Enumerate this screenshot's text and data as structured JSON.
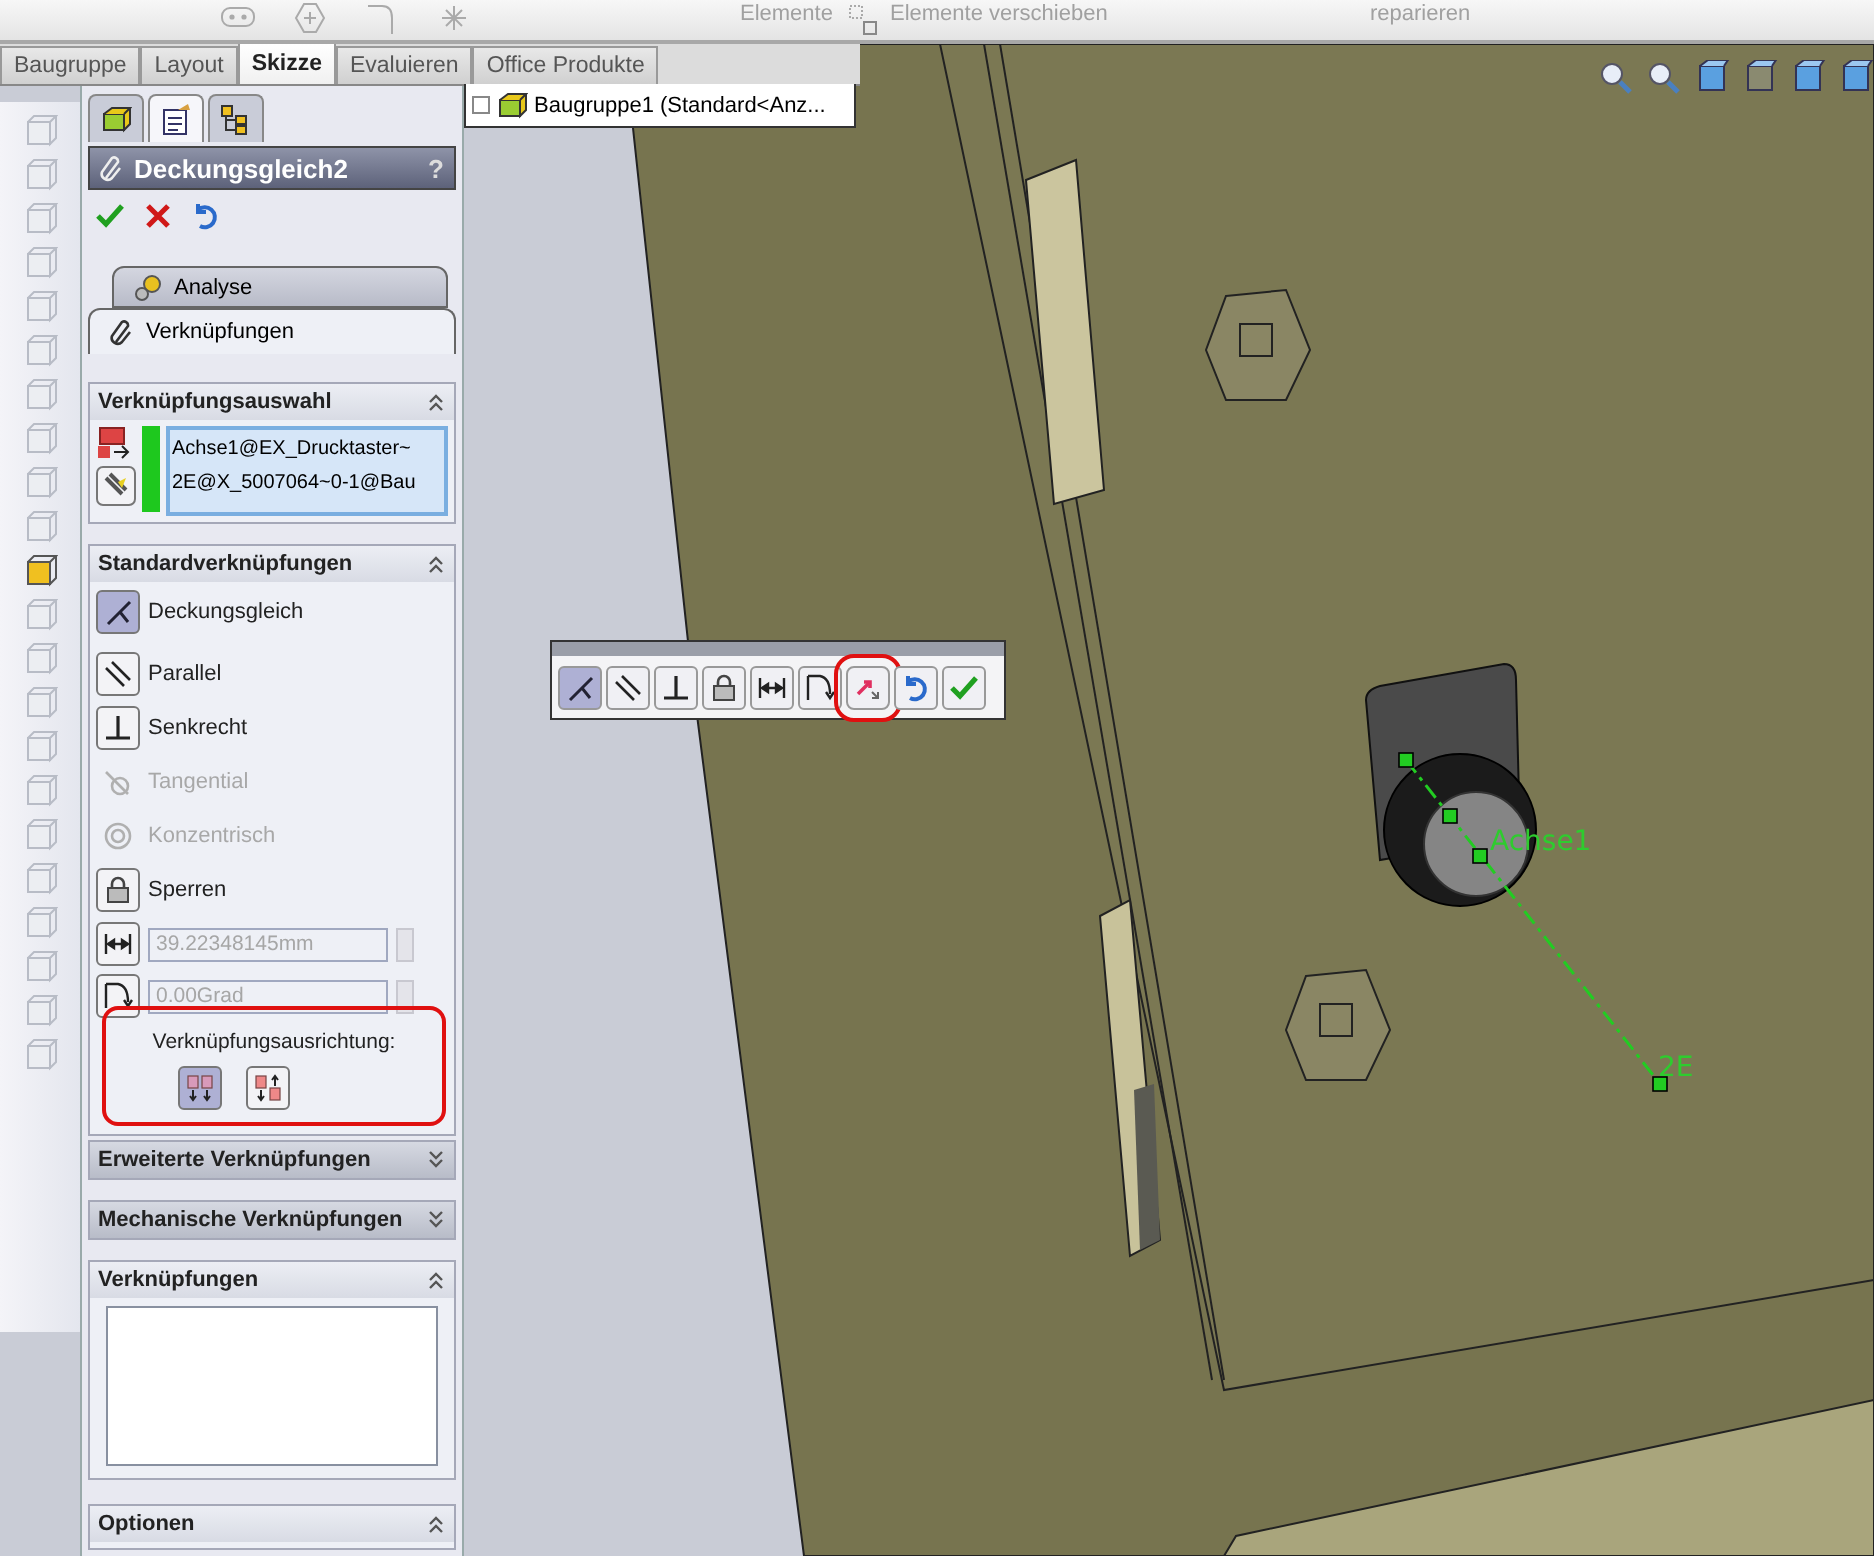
{
  "ribbon": {
    "labels": [
      "Elemente",
      "Elemente verschieben",
      "reparieren"
    ]
  },
  "tabs": [
    {
      "label": "Baugruppe",
      "selected": false
    },
    {
      "label": "Layout",
      "selected": false
    },
    {
      "label": "Skizze",
      "selected": true
    },
    {
      "label": "Evaluieren",
      "selected": false
    },
    {
      "label": "Office Produkte",
      "selected": false
    }
  ],
  "feature_tree": {
    "root": "Baugruppe1  (Standard<Anz..."
  },
  "property_manager": {
    "tabs": [
      {
        "kind": "tree",
        "selected": false
      },
      {
        "kind": "properties",
        "selected": true
      },
      {
        "kind": "config",
        "selected": false
      }
    ],
    "title": "Deckungsgleich2",
    "help": "?",
    "sub_tabs": [
      {
        "label": "Analyse",
        "selected": false
      },
      {
        "label": "Verknüpfungen",
        "selected": true
      }
    ],
    "sections": [
      {
        "kind": "selection",
        "title": "Verknüpfungsauswahl",
        "expanded": true,
        "entries": [
          "Achse1@EX_Drucktaster~",
          "2E@X_5007064~0-1@Bau"
        ]
      },
      {
        "kind": "mates",
        "title": "Standardverknüpfungen",
        "expanded": true,
        "items": [
          {
            "kind": "coincident",
            "label": "Deckungsgleich",
            "selected": true,
            "disabled": false
          },
          {
            "kind": "parallel",
            "label": "Parallel",
            "selected": false,
            "disabled": false
          },
          {
            "kind": "perpendicular",
            "label": "Senkrecht",
            "selected": false,
            "disabled": false
          },
          {
            "kind": "tangent",
            "label": "Tangential",
            "selected": false,
            "disabled": true
          },
          {
            "kind": "concentric",
            "label": "Konzentrisch",
            "selected": false,
            "disabled": true
          },
          {
            "kind": "lock",
            "label": "Sperren",
            "selected": false,
            "disabled": false
          }
        ],
        "fields": [
          {
            "kind": "distance",
            "value": "39.22348145mm",
            "disabled": true
          },
          {
            "kind": "angle",
            "value": "0.00Grad",
            "disabled": true
          }
        ],
        "alignment": {
          "label": "Verknüpfungsausrichtung:",
          "highlighted": true,
          "options": [
            {
              "kind": "aligned",
              "selected": true
            },
            {
              "kind": "anti",
              "selected": false
            }
          ]
        }
      },
      {
        "kind": "header",
        "title": "Erweiterte Verknüpfungen",
        "expanded": false
      },
      {
        "kind": "header",
        "title": "Mechanische Verknüpfungen",
        "expanded": false
      },
      {
        "kind": "list",
        "title": "Verknüpfungen",
        "expanded": true
      },
      {
        "kind": "header",
        "title": "Optionen",
        "expanded": true
      }
    ]
  },
  "mate_toolbar": [
    {
      "kind": "coincident",
      "selected": true,
      "highlighted": false
    },
    {
      "kind": "parallel",
      "selected": false,
      "highlighted": false
    },
    {
      "kind": "perpendicular",
      "selected": false,
      "highlighted": false
    },
    {
      "kind": "lock",
      "selected": false,
      "highlighted": false
    },
    {
      "kind": "distance",
      "selected": false,
      "highlighted": false
    },
    {
      "kind": "angle",
      "selected": false,
      "highlighted": false
    },
    {
      "kind": "flip",
      "selected": false,
      "highlighted": true
    },
    {
      "kind": "undo",
      "selected": false,
      "highlighted": false
    },
    {
      "kind": "ok",
      "selected": false,
      "highlighted": false
    }
  ],
  "viewport": {
    "labels": [
      "Achse1",
      "2E"
    ]
  }
}
